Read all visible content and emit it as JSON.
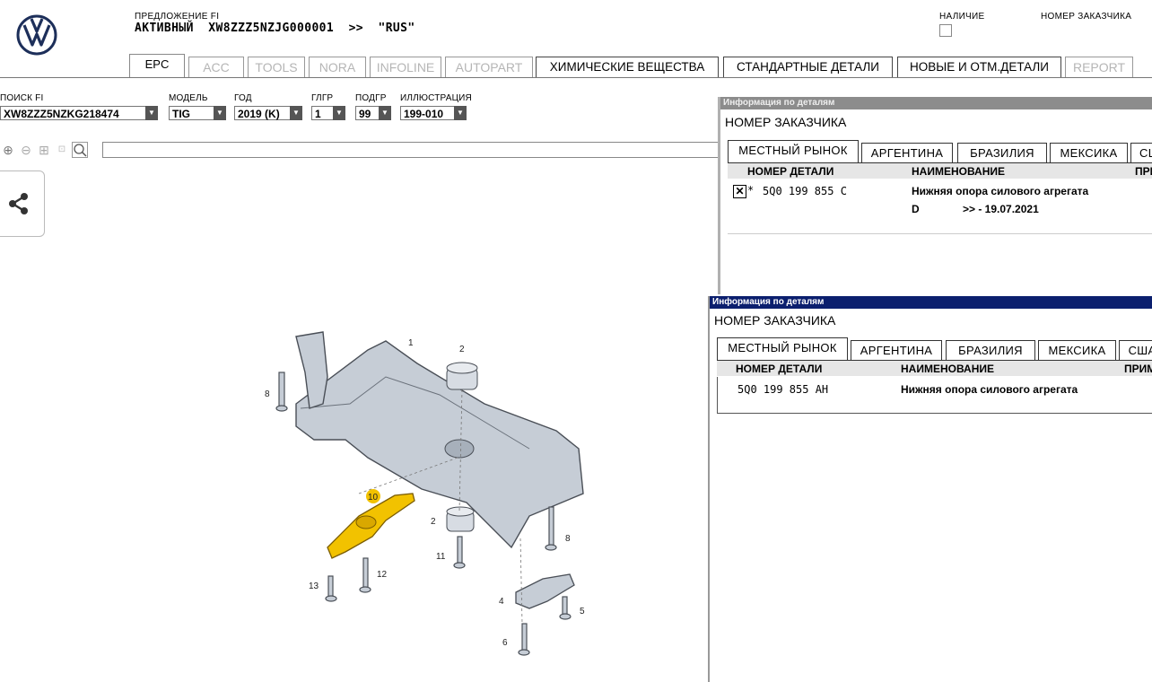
{
  "header": {
    "offer_label": "ПРЕДЛОЖЕНИЕ FI",
    "active_line": "АКТИВНЫЙ  XW8ZZZ5NZJG000001  >>  \"RUS\"",
    "availability_label": "НАЛИЧИЕ",
    "customer_number_label": "НОМЕР ЗАКАЗЧИКА"
  },
  "tabs": [
    {
      "label": "EPC"
    },
    {
      "label": "ACC"
    },
    {
      "label": "TOOLS"
    },
    {
      "label": "NORA"
    },
    {
      "label": "INFOLINE"
    },
    {
      "label": "AUTOPART"
    },
    {
      "label": "ХИМИЧЕСКИЕ ВЕЩЕСТВА"
    },
    {
      "label": "СТАНДАРТНЫЕ ДЕТАЛИ"
    },
    {
      "label": "НОВЫЕ И ОТМ.ДЕТАЛИ"
    },
    {
      "label": "REPORT"
    }
  ],
  "filters": {
    "search": {
      "label": "ПОИСК FI",
      "value": "XW8ZZZ5NZKG218474"
    },
    "model": {
      "label": "МОДЕЛЬ",
      "value": "TIG"
    },
    "year": {
      "label": "ГОД",
      "value": "2019 (K)"
    },
    "main_group": {
      "label": "ГЛГР",
      "value": "1"
    },
    "sub_group": {
      "label": "ПОДГР",
      "value": "99"
    },
    "illustration": {
      "label": "ИЛЛЮСТРАЦИЯ",
      "value": "199-010"
    }
  },
  "diagram": {
    "callouts": [
      "1",
      "2",
      "8",
      "10",
      "2",
      "11",
      "12",
      "13",
      "8",
      "4",
      "5",
      "6"
    ]
  },
  "panel1": {
    "title": "Информация по деталям",
    "customer_number": "НОМЕР ЗАКАЗЧИКА",
    "tabs": [
      "МЕСТНЫЙ РЫНОК",
      "АРГЕНТИНА",
      "БРАЗИЛИЯ",
      "МЕКСИКА",
      "СШ"
    ],
    "columns": {
      "part_number": "НОМЕР ДЕТАЛИ",
      "name": "НАИМЕНОВАНИЕ",
      "note": "ПРИ"
    },
    "row": {
      "flag": "*",
      "part_number": "5Q0 199 855 C",
      "name": "Нижняя опора силового агрегата",
      "detail_code": "D",
      "detail_date": ">> - 19.07.2021"
    }
  },
  "panel2": {
    "title": "Информация по деталям",
    "customer_number": "НОМЕР ЗАКАЗЧИКА",
    "tabs": [
      "МЕСТНЫЙ РЫНОК",
      "АРГЕНТИНА",
      "БРАЗИЛИЯ",
      "МЕКСИКА",
      "США"
    ],
    "columns": {
      "part_number": "НОМЕР ДЕТАЛИ",
      "name": "НАИМЕНОВАНИЕ",
      "note": "ПРИМ"
    },
    "row": {
      "part_number": "5Q0 199 855 AH",
      "name": "Нижняя опора силового агрегата"
    }
  },
  "colors": {
    "brand": "#1d2f5a",
    "panel_title_bg_inactive": "#8c8c8c",
    "panel_title_bg_active": "#0b1f6e",
    "highlight_part": "#f2c200"
  }
}
